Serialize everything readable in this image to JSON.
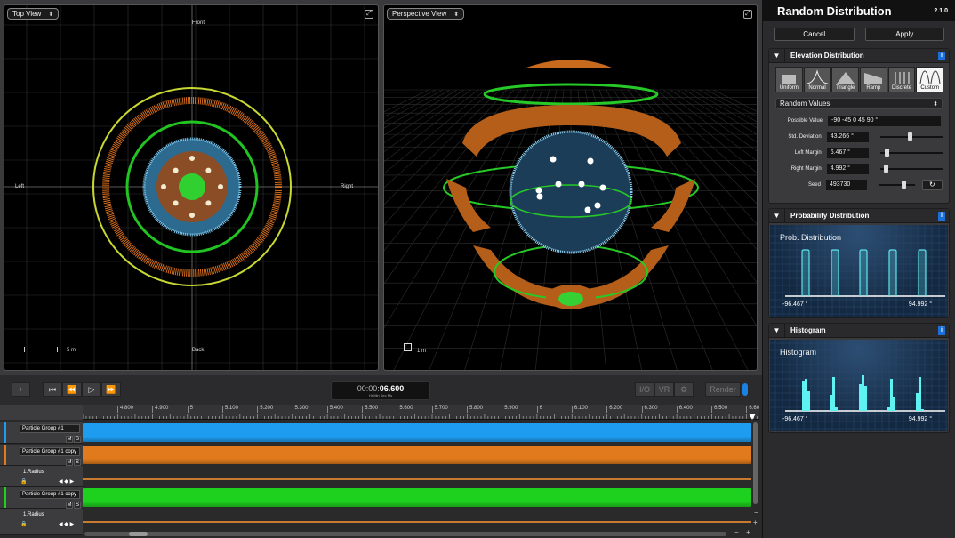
{
  "viewports": {
    "top": {
      "view_label": "Top View",
      "front": "Front",
      "back": "Back",
      "left": "Left",
      "right": "Right",
      "scale": "5 m"
    },
    "perspective": {
      "view_label": "Perspective View",
      "scale": "1 m"
    }
  },
  "panel": {
    "title": "Random Distribution",
    "version": "2.1.0",
    "cancel": "Cancel",
    "apply": "Apply",
    "elevation": {
      "title": "Elevation Distribution",
      "shapes": [
        "Uniform",
        "Normal",
        "Triangle",
        "Ramp",
        "Discrete",
        "Custom"
      ],
      "selected_shape": "Custom",
      "mode": "Random Values",
      "fields": [
        {
          "label": "Possible Value",
          "value": "-90 -45 0 45 90 °"
        },
        {
          "label": "Std. Deviation",
          "value": "43.266 °",
          "slider": 0.47
        },
        {
          "label": "Left Margin",
          "value": "6.467 °",
          "slider": 0.08
        },
        {
          "label": "Right Margin",
          "value": "4.992 °",
          "slider": 0.06
        },
        {
          "label": "Seed",
          "value": "493730",
          "slider": 0.68
        }
      ]
    },
    "probability": {
      "section_title": "Probability Distribution",
      "graph_title": "Prob. Distribution",
      "min_label": "-96.467 °",
      "max_label": "94.992 °"
    },
    "histogram": {
      "section_title": "Histogram",
      "graph_title": "Histogram",
      "min_label": "-96.467 °",
      "max_label": "94.992 °"
    }
  },
  "toolbar": {
    "add": "+",
    "timecode": "00:00:",
    "timecode_bold": "06.600",
    "timecode_units": "Hr  Min  Sec  Ms",
    "io": "I/O",
    "vr": "VR",
    "render": "Render"
  },
  "timeline": {
    "ruler": [
      "4.800",
      "4.900",
      "5",
      "5.100",
      "5.200",
      "5.300",
      "5.400",
      "5.500",
      "5.600",
      "5.700",
      "5.800",
      "5.900",
      "6",
      "6.100",
      "6.200",
      "6.300",
      "6.400",
      "6.500",
      "6.60"
    ],
    "tracks": [
      {
        "name": "Particle Group #1",
        "color": "#1e9df0"
      },
      {
        "name": "Particle Group #1 copy",
        "color": "#e07a1c",
        "sub": "1.Radius"
      },
      {
        "name": "Particle Group #1 copy",
        "color": "#1fd11f",
        "sub": "1.Radius"
      }
    ],
    "mute": "M",
    "solo": "S"
  }
}
